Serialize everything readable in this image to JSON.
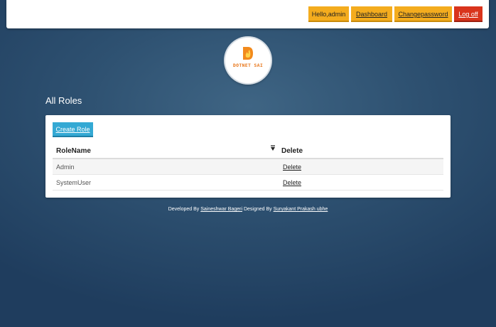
{
  "header": {
    "hello": "Hello,admin",
    "dashboard": "Dashboard",
    "change_password": "Changepassword",
    "logoff": "Log off"
  },
  "logo": {
    "text": "DOTNET SAI",
    "icon": "d-flame-logo"
  },
  "page": {
    "title": "All Roles"
  },
  "toolbar": {
    "create_role": "Create Role"
  },
  "table": {
    "columns": [
      "RoleName",
      "Delete"
    ],
    "rows": [
      {
        "role": "Admin",
        "action": "Delete"
      },
      {
        "role": "SystemUser",
        "action": "Delete"
      }
    ]
  },
  "footer": {
    "developed_by": "Developed By",
    "developer": "Saineshwar Bageri",
    "designed_by": "Designed By",
    "designer": "Suryakant Prakash ubhe"
  },
  "colors": {
    "nav_yellow": "#f4ac1e",
    "nav_red": "#d9341c",
    "button_blue": "#34a9d4",
    "background": "#2e5171"
  }
}
